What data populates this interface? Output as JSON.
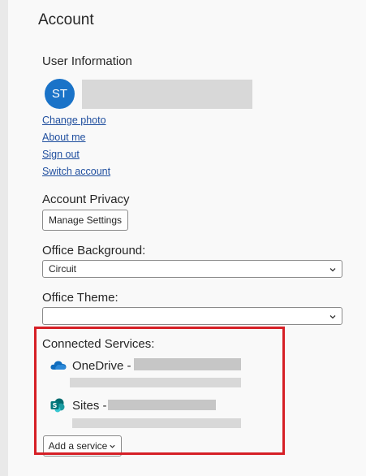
{
  "page": {
    "title": "Account"
  },
  "user_information": {
    "heading": "User Information",
    "avatar_initials": "ST",
    "links": [
      "Change photo",
      "About me",
      "Sign out",
      "Switch account"
    ]
  },
  "account_privacy": {
    "heading": "Account Privacy",
    "button_label": "Manage Settings"
  },
  "office_background": {
    "heading": "Office Background:",
    "selected": "Circuit"
  },
  "office_theme": {
    "heading": "Office Theme:",
    "selected": ""
  },
  "connected_services": {
    "heading": "Connected Services:",
    "services": [
      {
        "name": "OneDrive -",
        "icon": "onedrive-cloud-icon"
      },
      {
        "name": "Sites -",
        "icon": "sharepoint-icon"
      }
    ],
    "add_button_label": "Add a service"
  },
  "colors": {
    "accent_blue": "#1a73c8",
    "link_blue": "#1f4e9e",
    "highlight_red": "#d61f26",
    "sharepoint_teal": "#036c70"
  }
}
